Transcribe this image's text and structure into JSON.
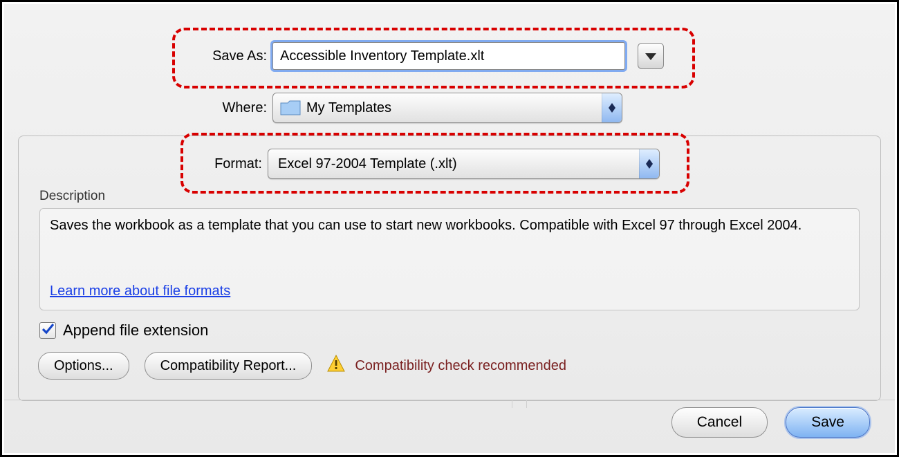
{
  "saveAs": {
    "label": "Save As:",
    "value": "Accessible Inventory Template.xlt"
  },
  "where": {
    "label": "Where:",
    "value": "My Templates"
  },
  "format": {
    "label": "Format:",
    "value": "Excel 97-2004 Template (.xlt)"
  },
  "description": {
    "heading": "Description",
    "text": "Saves the workbook as a template that you can use to start new workbooks. Compatible with Excel 97 through Excel 2004.",
    "link": "Learn more about file formats"
  },
  "appendExt": {
    "label": "Append file extension",
    "checked": true
  },
  "warning": {
    "text": "Compatibility check recommended"
  },
  "buttons": {
    "options": "Options...",
    "compat": "Compatibility Report...",
    "cancel": "Cancel",
    "save": "Save"
  }
}
